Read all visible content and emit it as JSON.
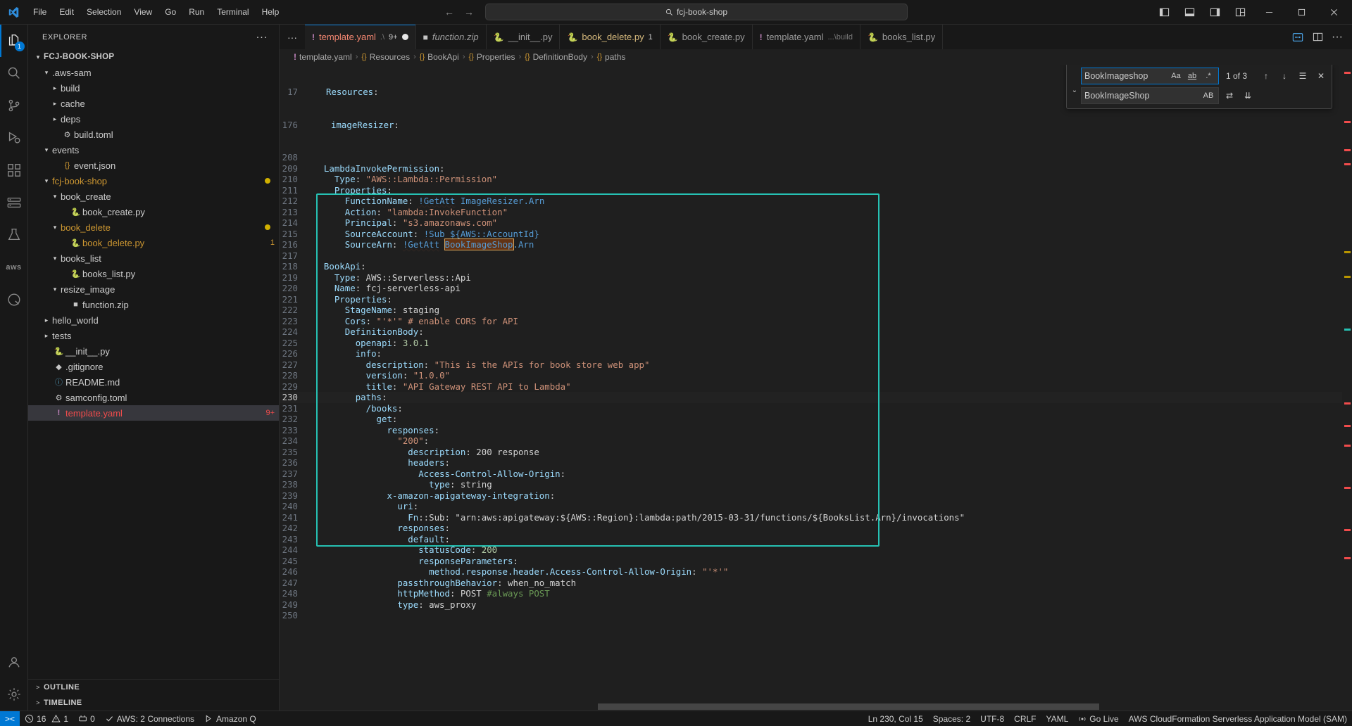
{
  "titlebar": {
    "menu": [
      "File",
      "Edit",
      "Selection",
      "View",
      "Go",
      "Run",
      "Terminal",
      "Help"
    ],
    "search_placeholder": "fcj-book-shop",
    "nav_back": "←",
    "nav_forward": "→"
  },
  "activitybar": {
    "items": [
      {
        "name": "explorer",
        "badge": "1"
      },
      {
        "name": "search",
        "badge": ""
      },
      {
        "name": "source-control",
        "badge": ""
      },
      {
        "name": "run-and-debug",
        "badge": ""
      },
      {
        "name": "extensions",
        "badge": ""
      },
      {
        "name": "remote-explorer",
        "badge": ""
      },
      {
        "name": "testing",
        "badge": ""
      },
      {
        "name": "aws-toolkit",
        "badge": ""
      },
      {
        "name": "amazon-q",
        "badge": ""
      }
    ]
  },
  "sidebar": {
    "title": "EXPLORER",
    "more_actions": "···",
    "tree": [
      {
        "label": "FCJ-BOOK-SHOP",
        "indent": 0,
        "twist": "v",
        "icon": "",
        "kind": "root"
      },
      {
        "label": ".aws-sam",
        "indent": 1,
        "twist": "v",
        "icon": "",
        "kind": "folder"
      },
      {
        "label": "build",
        "indent": 2,
        "twist": ">",
        "icon": "",
        "kind": "folder"
      },
      {
        "label": "cache",
        "indent": 2,
        "twist": ">",
        "icon": "",
        "kind": "folder"
      },
      {
        "label": "deps",
        "indent": 2,
        "twist": ">",
        "icon": "",
        "kind": "folder"
      },
      {
        "label": "build.toml",
        "indent": 2,
        "twist": "",
        "icon": "gear",
        "kind": "file"
      },
      {
        "label": "events",
        "indent": 1,
        "twist": "v",
        "icon": "",
        "kind": "folder"
      },
      {
        "label": "event.json",
        "indent": 2,
        "twist": "",
        "icon": "json",
        "kind": "file"
      },
      {
        "label": "fcj-book-shop",
        "indent": 1,
        "twist": "v",
        "icon": "",
        "kind": "folder",
        "color": "yellow",
        "dirty": true
      },
      {
        "label": "book_create",
        "indent": 2,
        "twist": "v",
        "icon": "",
        "kind": "folder"
      },
      {
        "label": "book_create.py",
        "indent": 3,
        "twist": "",
        "icon": "python",
        "kind": "file"
      },
      {
        "label": "book_delete",
        "indent": 2,
        "twist": "v",
        "icon": "",
        "kind": "folder",
        "color": "yellow",
        "dirty": true
      },
      {
        "label": "book_delete.py",
        "indent": 3,
        "twist": "",
        "icon": "python",
        "kind": "file",
        "color": "yellow",
        "badge": "1"
      },
      {
        "label": "books_list",
        "indent": 2,
        "twist": "v",
        "icon": "",
        "kind": "folder"
      },
      {
        "label": "books_list.py",
        "indent": 3,
        "twist": "",
        "icon": "python",
        "kind": "file"
      },
      {
        "label": "resize_image",
        "indent": 2,
        "twist": "v",
        "icon": "",
        "kind": "folder"
      },
      {
        "label": "function.zip",
        "indent": 3,
        "twist": "",
        "icon": "zip",
        "kind": "file"
      },
      {
        "label": "hello_world",
        "indent": 1,
        "twist": ">",
        "icon": "",
        "kind": "folder"
      },
      {
        "label": "tests",
        "indent": 1,
        "twist": ">",
        "icon": "",
        "kind": "folder"
      },
      {
        "label": "__init__.py",
        "indent": 1,
        "twist": "",
        "icon": "python",
        "kind": "file"
      },
      {
        "label": ".gitignore",
        "indent": 1,
        "twist": "",
        "icon": "git",
        "kind": "file"
      },
      {
        "label": "README.md",
        "indent": 1,
        "twist": "",
        "icon": "info",
        "kind": "file"
      },
      {
        "label": "samconfig.toml",
        "indent": 1,
        "twist": "",
        "icon": "gear",
        "kind": "file"
      },
      {
        "label": "template.yaml",
        "indent": 1,
        "twist": "",
        "icon": "warn",
        "kind": "file",
        "color": "red",
        "badge": "9+",
        "selected": true
      }
    ],
    "bottom_panels": [
      {
        "label": "OUTLINE",
        "chev": ">"
      },
      {
        "label": "TIMELINE",
        "chev": ">"
      }
    ]
  },
  "tabs": [
    {
      "label": "template.yaml",
      "sub": ".\\",
      "icon": "warn",
      "count": "9+",
      "dirty": true,
      "active": true,
      "color": "red"
    },
    {
      "label": "function.zip",
      "sub": "",
      "icon": "zip",
      "count": "",
      "dirty": false,
      "active": false,
      "italic": true
    },
    {
      "label": "__init__.py",
      "sub": "",
      "icon": "python",
      "count": "",
      "dirty": false,
      "active": false
    },
    {
      "label": "book_delete.py",
      "sub": "",
      "icon": "python",
      "count": "1",
      "dirty": false,
      "active": false,
      "color": "yellow"
    },
    {
      "label": "book_create.py",
      "sub": "",
      "icon": "python",
      "count": "",
      "dirty": false,
      "active": false
    },
    {
      "label": "template.yaml",
      "sub": "...\\build",
      "icon": "warn",
      "count": "",
      "dirty": false,
      "active": false
    },
    {
      "label": "books_list.py",
      "sub": "",
      "icon": "python",
      "count": "",
      "dirty": false,
      "active": false
    }
  ],
  "breadcrumb": [
    {
      "text": "template.yaml",
      "icon": "warn"
    },
    {
      "text": "Resources",
      "icon": "braces"
    },
    {
      "text": "BookApi",
      "icon": "braces"
    },
    {
      "text": "Properties",
      "icon": "braces"
    },
    {
      "text": "DefinitionBody",
      "icon": "braces"
    },
    {
      "text": "paths",
      "icon": "braces"
    }
  ],
  "find": {
    "search_value": "BookImageshop",
    "replace_value": "BookImageShop",
    "match_count": "1 of 3",
    "toggle_replace": "⌄",
    "match_case": "Aa",
    "whole_word": "ab",
    "regex": ".*",
    "preserve_case": "AB",
    "prev": "↑",
    "next": "↓",
    "find_in_selection": "☰",
    "close": "✕",
    "replace_one": "⇄",
    "replace_all": "⇊"
  },
  "editor": {
    "top_lines": [
      {
        "num": "17",
        "indent": 2,
        "html": "<span class=\"k\">Resources</span><span class=\"punc\">:</span>"
      },
      {
        "num": "176",
        "indent": 4,
        "html": "<span class=\"k\">imageResizer</span><span class=\"punc\">:</span>"
      }
    ],
    "lines": [
      {
        "num": "208",
        "text": ""
      },
      {
        "num": "209",
        "text": "  LambdaInvokePermission:"
      },
      {
        "num": "210",
        "text": "    Type: \"AWS::Lambda::Permission\""
      },
      {
        "num": "211",
        "text": "    Properties:"
      },
      {
        "num": "212",
        "text": "      FunctionName: !GetAtt ImageResizer.Arn"
      },
      {
        "num": "213",
        "text": "      Action: \"lambda:InvokeFunction\""
      },
      {
        "num": "214",
        "text": "      Principal: \"s3.amazonaws.com\""
      },
      {
        "num": "215",
        "text": "      SourceAccount: !Sub ${AWS::AccountId}"
      },
      {
        "num": "216",
        "text": "      SourceArn: !GetAtt BookImageShop.Arn"
      },
      {
        "num": "217",
        "text": ""
      },
      {
        "num": "218",
        "text": "  BookApi:"
      },
      {
        "num": "219",
        "text": "    Type: AWS::Serverless::Api"
      },
      {
        "num": "220",
        "text": "    Name: fcj-serverless-api"
      },
      {
        "num": "221",
        "text": "    Properties:"
      },
      {
        "num": "222",
        "text": "      StageName: staging"
      },
      {
        "num": "223",
        "text": "      Cors: \"'*'\" # enable CORS for API"
      },
      {
        "num": "224",
        "text": "      DefinitionBody:"
      },
      {
        "num": "225",
        "text": "        openapi: 3.0.1"
      },
      {
        "num": "226",
        "text": "        info:"
      },
      {
        "num": "227",
        "text": "          description: \"This is the APIs for book store web app\""
      },
      {
        "num": "228",
        "text": "          version: \"1.0.0\""
      },
      {
        "num": "229",
        "text": "          title: \"API Gateway REST API to Lambda\""
      },
      {
        "num": "230",
        "text": "        paths:"
      },
      {
        "num": "231",
        "text": "          /books:"
      },
      {
        "num": "232",
        "text": "            get:"
      },
      {
        "num": "233",
        "text": "              responses:"
      },
      {
        "num": "234",
        "text": "                \"200\":"
      },
      {
        "num": "235",
        "text": "                  description: 200 response"
      },
      {
        "num": "236",
        "text": "                  headers:"
      },
      {
        "num": "237",
        "text": "                    Access-Control-Allow-Origin:"
      },
      {
        "num": "238",
        "text": "                      type: string"
      },
      {
        "num": "239",
        "text": "              x-amazon-apigateway-integration:"
      },
      {
        "num": "240",
        "text": "                uri:"
      },
      {
        "num": "241",
        "text": "                  Fn::Sub: \"arn:aws:apigateway:${AWS::Region}:lambda:path/2015-03-31/functions/${BooksList.Arn}/invocations\""
      },
      {
        "num": "242",
        "text": "                responses:"
      },
      {
        "num": "243",
        "text": "                  default:"
      },
      {
        "num": "244",
        "text": "                    statusCode: 200"
      },
      {
        "num": "245",
        "text": "                    responseParameters:"
      },
      {
        "num": "246",
        "text": "                      method.response.header.Access-Control-Allow-Origin: \"'*'\""
      },
      {
        "num": "247",
        "text": "                passthroughBehavior: when_no_match"
      },
      {
        "num": "248",
        "text": "                httpMethod: POST #always POST"
      },
      {
        "num": "249",
        "text": "                type: aws_proxy"
      },
      {
        "num": "250",
        "text": ""
      }
    ]
  },
  "statusbar": {
    "remote_icon": "><",
    "errors": "16",
    "warnings": "1",
    "ports": "0",
    "aws_connections": "AWS: 2 Connections",
    "amazon_q": "Amazon Q",
    "cursor_position": "Ln 230, Col 15",
    "spaces": "Spaces: 2",
    "encoding": "UTF-8",
    "eol": "CRLF",
    "language": "YAML",
    "go_live": "Go Live",
    "sam_label": "AWS CloudFormation Serverless Application Model (SAM)"
  }
}
